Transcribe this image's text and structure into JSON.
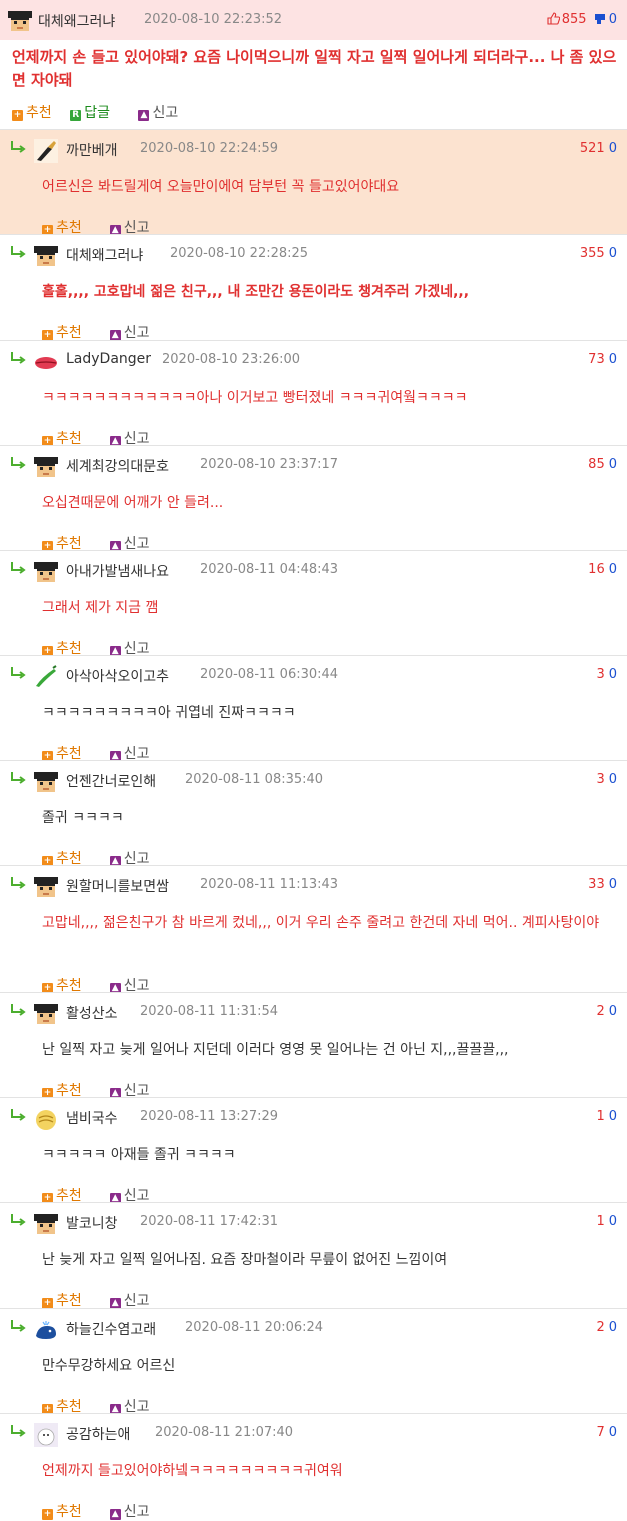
{
  "main_post": {
    "nick": "대체왜그러냐",
    "date": "2020-08-10 22:23:52",
    "up_count": "855",
    "down_count": "0",
    "text": "언제까지 손 들고 있어야돼? 요즘 나이먹으니까 일찍 자고 일찍 일어나게 되더라구... 나 좀 있으면 자야돼",
    "actions": {
      "recommend": "추천",
      "reply": "답글",
      "report": "신고"
    }
  },
  "comment_actions": {
    "recommend": "추천",
    "report": "신고"
  },
  "comments": [
    {
      "nick": "까만베개",
      "date": "2020-08-10 22:24:59",
      "up": "521",
      "down": "0",
      "text": "어르신은 봐드릴게여 오늘만이에여 담부턴 꼭 들고있어야대요",
      "avatar": "brush"
    },
    {
      "nick": "대체왜그러냐",
      "date": "2020-08-10 22:28:25",
      "up": "355",
      "down": "0",
      "text": "홀홀,,,, 고호맙네 젊은 친구,,, 내 조만간 용돈이라도 챙겨주러 가겠네,,,",
      "avatar": "pixel"
    },
    {
      "nick": "LadyDanger",
      "date": "2020-08-10 23:26:00",
      "up": "73",
      "down": "0",
      "text": "ㅋㅋㅋㅋㅋㅋㅋㅋㅋㅋㅋㅋ아나 이거보고 빵터졌네 ㅋㅋㅋ귀여웤ㅋㅋㅋㅋ",
      "avatar": "lips"
    },
    {
      "nick": "세계최강의대문호",
      "date": "2020-08-10 23:37:17",
      "up": "85",
      "down": "0",
      "text": "오십견때문에 어깨가 안 들려...",
      "avatar": "pixel"
    },
    {
      "nick": "아내가발냄새나요",
      "date": "2020-08-11 04:48:43",
      "up": "16",
      "down": "0",
      "text": "그래서 제가 지금 깸",
      "avatar": "pixel"
    },
    {
      "nick": "아삭아삭오이고추",
      "date": "2020-08-11 06:30:44",
      "up": "3",
      "down": "0",
      "text": "ㅋㅋㅋㅋㅋㅋㅋㅋㅋ아 귀엽네 진짜ㅋㅋㅋㅋ",
      "avatar": "pepper"
    },
    {
      "nick": "언젠간너로인해",
      "date": "2020-08-11 08:35:40",
      "up": "3",
      "down": "0",
      "text": "졸귀 ㅋㅋㅋㅋ",
      "avatar": "pixel"
    },
    {
      "nick": "원할머니를보면쌈",
      "date": "2020-08-11 11:13:43",
      "up": "33",
      "down": "0",
      "text": "고맙네,,,, 젊은친구가 참 바르게 컸네,,, 이거 우리 손주 줄려고 한건데 자네 먹어.. 계피사탕이야",
      "avatar": "pixel"
    },
    {
      "nick": "활성산소",
      "date": "2020-08-11 11:31:54",
      "up": "2",
      "down": "0",
      "text": "난 일찍 자고 늦게 일어나 지던데 이러다 영영 못 일어나는 건 아닌 지,,,끌끌끌,,,",
      "avatar": "pixel"
    },
    {
      "nick": "냄비국수",
      "date": "2020-08-11 13:27:29",
      "up": "1",
      "down": "0",
      "text": "ㅋㅋㅋㅋㅋ 아재들 졸귀 ㅋㅋㅋㅋ",
      "avatar": "noodle"
    },
    {
      "nick": "발코니창",
      "date": "2020-08-11 17:42:31",
      "up": "1",
      "down": "0",
      "text": "난 늦게 자고 일찍 일어나짐. 요즘 장마철이라 무릎이 없어진 느낌이여",
      "avatar": "pixel"
    },
    {
      "nick": "하늘긴수염고래",
      "date": "2020-08-11 20:06:24",
      "up": "2",
      "down": "0",
      "text": "만수무강하세요 어르신",
      "avatar": "whale"
    },
    {
      "nick": "공감하는애",
      "date": "2020-08-11 21:07:40",
      "up": "7",
      "down": "0",
      "text": "언제까지 들고있어야하넼ㅋㅋㅋㅋㅋㅋㅋㅋㅋ귀여워",
      "avatar": "moomin"
    }
  ]
}
